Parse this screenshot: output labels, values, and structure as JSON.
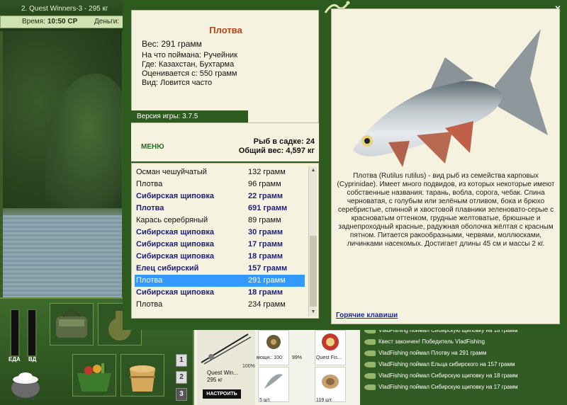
{
  "game": {
    "title": "2. Quest Winners-3 - 295 кг",
    "time_label": "Время:",
    "time_value": "10:50 СР",
    "money_label": "Деньги:"
  },
  "status": {
    "food_label": "ЕДА",
    "drink_label": "ВД"
  },
  "pages": [
    "1",
    "2",
    "3"
  ],
  "dialog": {
    "close": "x",
    "fish_name": "Плотва",
    "weight": "Вес: 291 грамм",
    "caught_with": "На что поймана: Ручейник",
    "location": "Где: Казахстан, Бухтарма",
    "valued_from": "Оценивается с: 550 грамм",
    "kind": "Вид: Ловится часто",
    "version": "Версия игры: 3.7.5",
    "menu_label": "МЕНЮ",
    "catch_count": "Рыб в садке: 24",
    "total_weight": "Общий вес: 4,597 кг",
    "catch": [
      {
        "name": "Осман чешуйчатый",
        "mass": "132 грамм",
        "bold": false,
        "selected": false
      },
      {
        "name": "Плотва",
        "mass": "96 грамм",
        "bold": false,
        "selected": false
      },
      {
        "name": "Сибирская щиповка",
        "mass": "22 грамм",
        "bold": true,
        "selected": false
      },
      {
        "name": "Плотва",
        "mass": "691 грамм",
        "bold": true,
        "selected": false
      },
      {
        "name": "Карась серебряный",
        "mass": "89 грамм",
        "bold": false,
        "selected": false
      },
      {
        "name": "Сибирская щиповка",
        "mass": "30 грамм",
        "bold": true,
        "selected": false
      },
      {
        "name": "Сибирская щиповка",
        "mass": "17 грамм",
        "bold": true,
        "selected": false
      },
      {
        "name": "Сибирская щиповка",
        "mass": "18 грамм",
        "bold": true,
        "selected": false
      },
      {
        "name": "Елец сибирский",
        "mass": "157 грамм",
        "bold": true,
        "selected": false
      },
      {
        "name": "Плотва",
        "mass": "291 грамм",
        "bold": false,
        "selected": true
      },
      {
        "name": "Сибирская щиповка",
        "mass": "18 грамм",
        "bold": true,
        "selected": false
      },
      {
        "name": "Плотва",
        "mass": "234 грамм",
        "bold": false,
        "selected": false
      }
    ],
    "description": "Плотва (Rutilus rutilus) - вид рыб из семейства карповых (Cyprinidae). Имеет много подвидов, из которых некоторые имеют собственные названия: тарань, вобла, сорога, чебак. Спина черноватая, с голубым или зелёным отливом, бока и брюхо серебристые, спинной и хвостовой плавники зеленовато-серые с красноватым оттенком, грудные желтоватые, брюшные и заднепроходный красные, радужная оболочка жёлтая с красным пятном. Питается ракообразными, червями, моллюсками, личинками насекомых. Достигает длины 45 см и массы 2 кг.",
    "hotkeys": "Горячие клавиши"
  },
  "tackle": {
    "rod_name": "Quest Win...",
    "rod_weight": "295 кг",
    "rod_percent": "100%",
    "setup_label": "НАСТРОИТЬ",
    "reel_power": "мощн.: 100",
    "reel_percent": "99%",
    "line_name": "Quest Fis...",
    "lure_qty": "5 шт.",
    "bait_qty": "119 шт."
  },
  "log": [
    "VladFishing поймал Сибирскую щиповку на 18 грамм",
    "Квест закончен! Победитель VladFishing",
    "VladFishing поймал Плотву на 291 грамм",
    "VladFishing поймал Ельца сибирского на 157 грамм",
    "VladFishing поймал Сибирскую щиповку на 18 грамм",
    "VladFishing поймал Сибирскую щиповку на 17 грамм"
  ]
}
